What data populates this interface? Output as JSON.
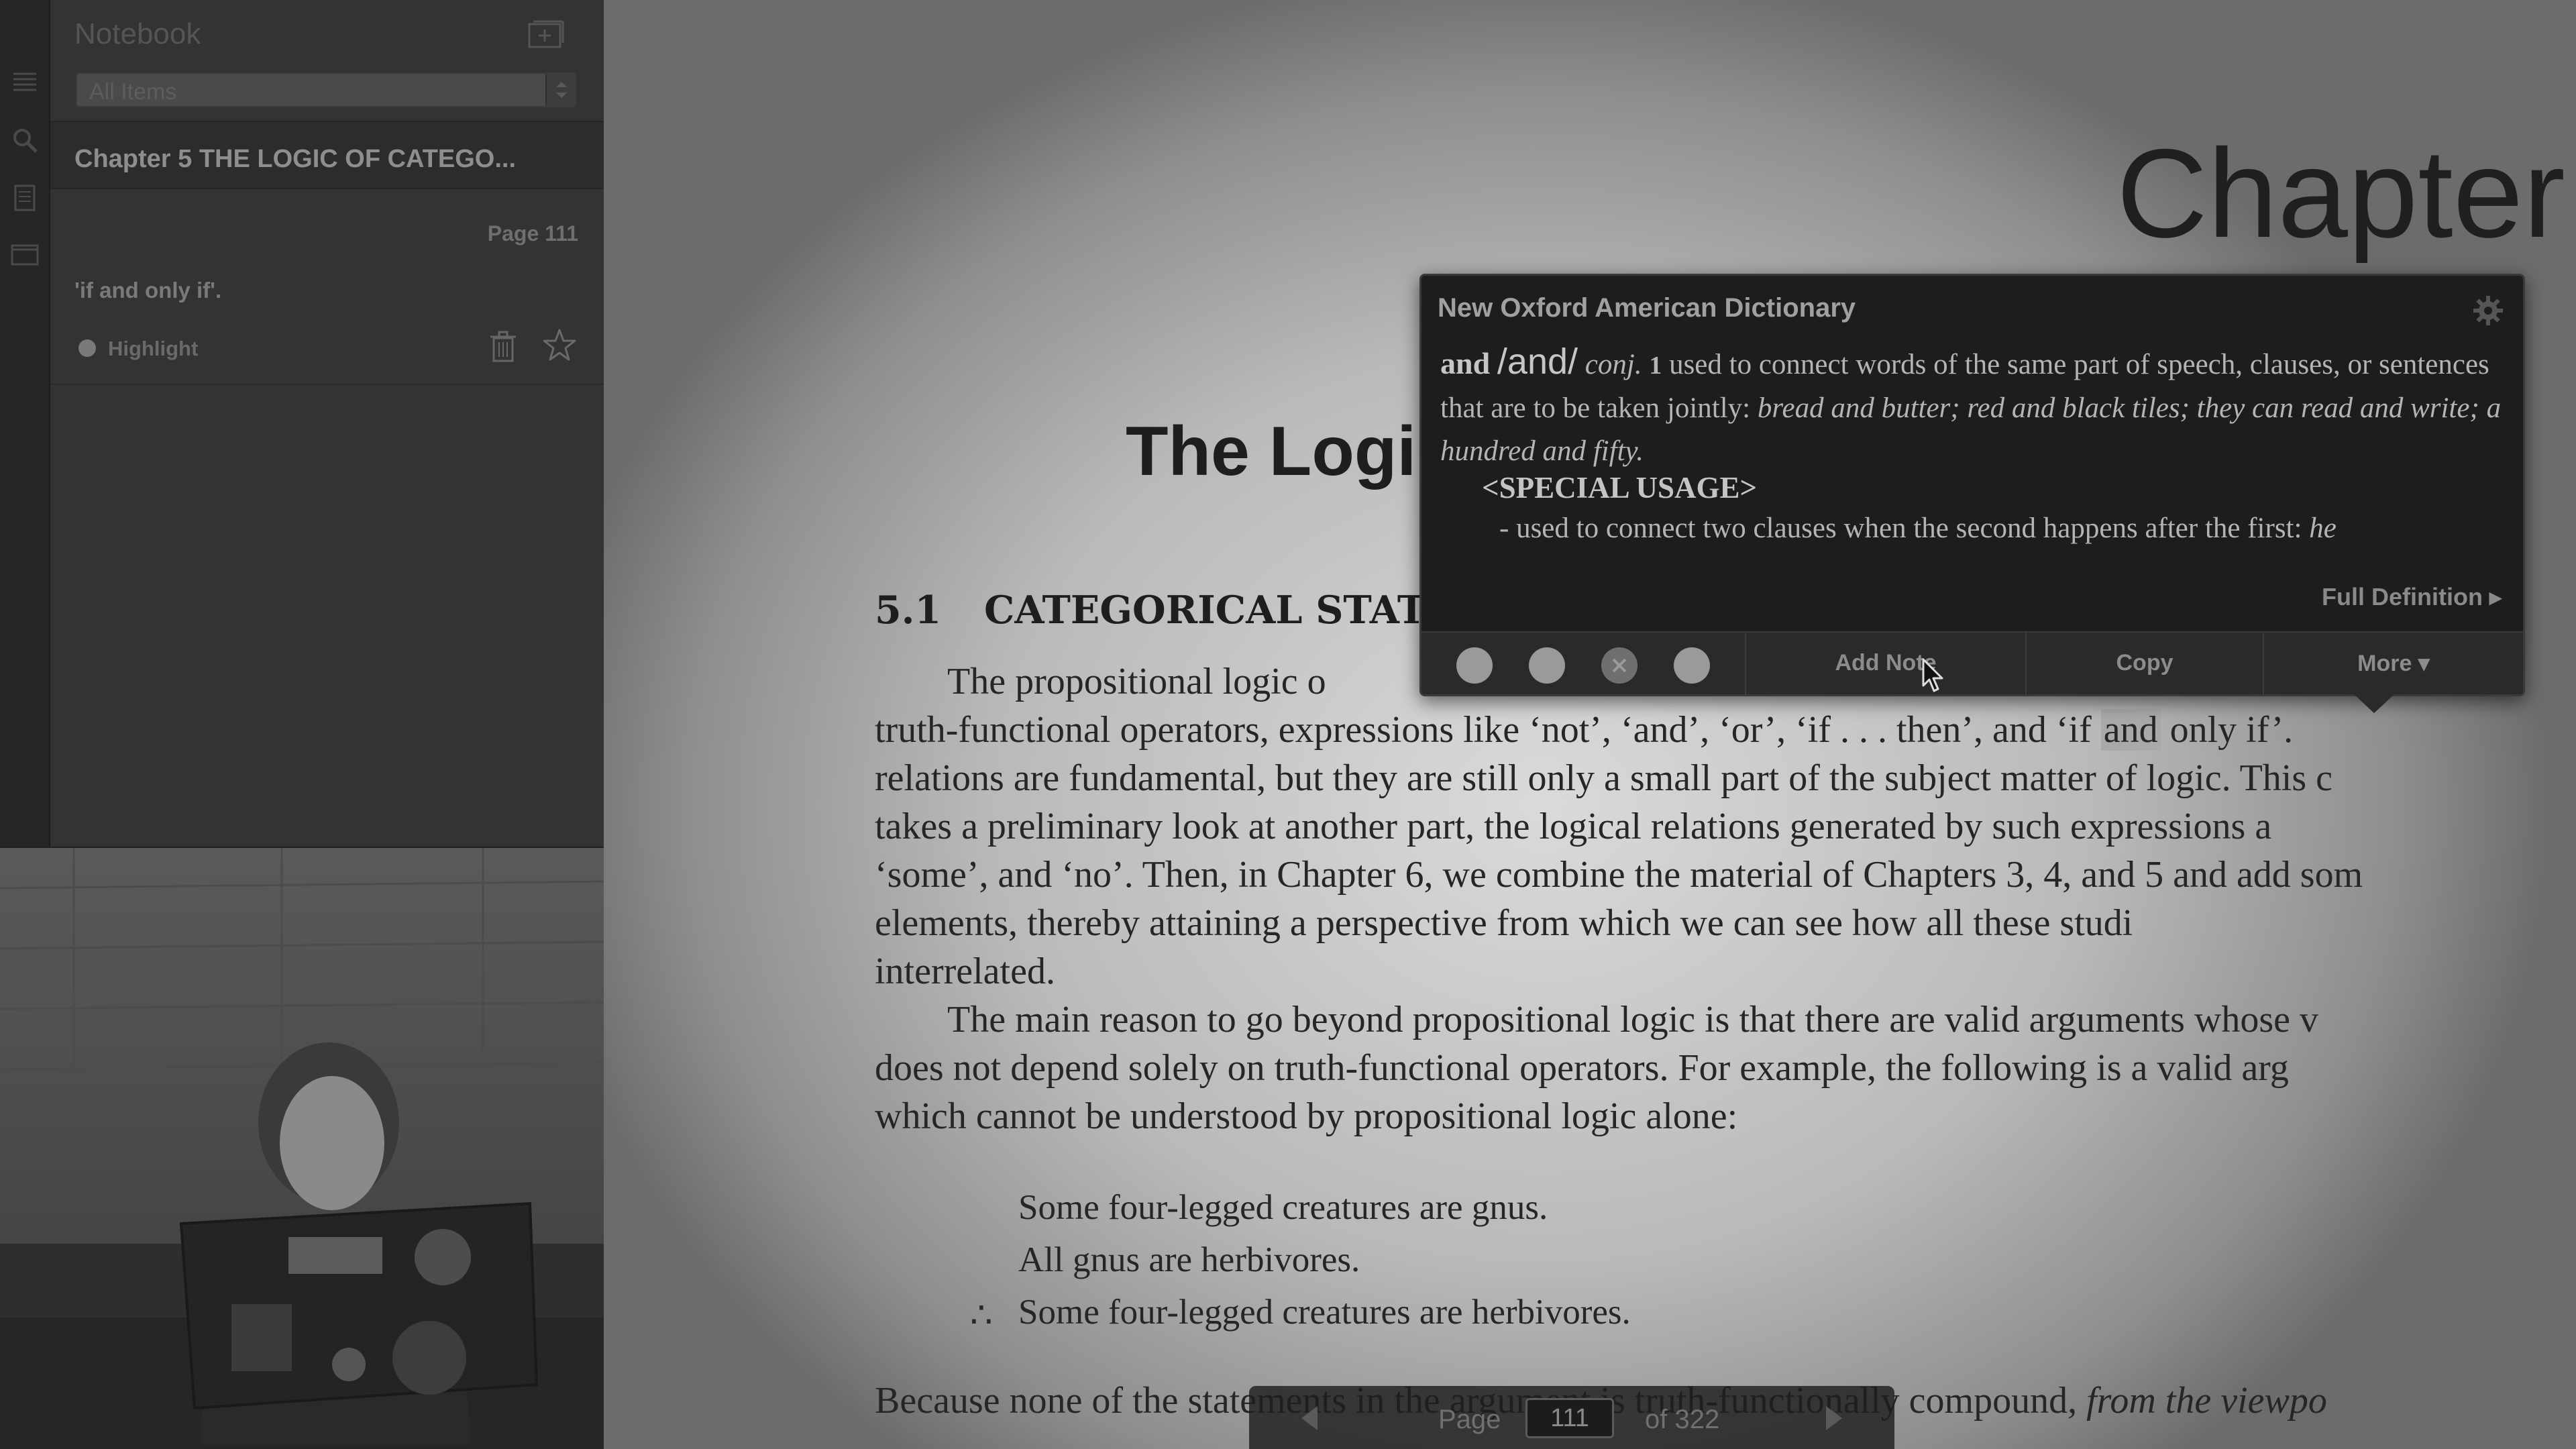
{
  "sidebar": {
    "notebook_title": "Notebook",
    "filter_value": "All Items",
    "chapter_title": "Chapter 5 THE LOGIC OF CATEGO...",
    "note": {
      "page": "Page 111",
      "quote": "'if and only if'.",
      "type_label": "Highlight"
    },
    "rail_icons": [
      "list-icon",
      "search-icon",
      "page-icon",
      "notebook-icon"
    ]
  },
  "document": {
    "chapter_word": "Chapter",
    "heading_fragment": "The Logi",
    "section_number": "5.1",
    "section_title": "CATEGORICAL STATE",
    "lines": [
      {
        "text": "The propositional logic o",
        "indent": true
      },
      {
        "text": "truth-functional operators, expressions like ‘not’, ‘and’, ‘or’, ‘if . . . then’, and ‘if ",
        "highlight": "and",
        "after": " only if’.",
        "indent": false
      },
      {
        "text": "relations are fundamental, but they are still only a small part of the subject matter of logic. This c",
        "indent": false
      },
      {
        "text": "takes a preliminary look at another part, the logical relations generated by such expressions a",
        "indent": false
      },
      {
        "text": "‘some’, and ‘no’. Then, in Chapter 6, we combine the material of Chapters 3, 4, and 5 and add som",
        "indent": false
      },
      {
        "text": "elements, thereby attaining a perspective from which we can see how all these studi",
        "indent": false
      },
      {
        "text": "interrelated.",
        "indent": false
      },
      {
        "text": "The main reason to go beyond propositional logic is that there are valid arguments whose v",
        "indent": true
      },
      {
        "text": "does not depend solely on truth-functional operators. For example, the following is a valid arg",
        "indent": false
      },
      {
        "text": "which cannot be understood by propositional logic alone:",
        "indent": false
      }
    ],
    "argument": [
      "Some four-legged creatures are gnus.",
      "All gnus are herbivores.",
      "Some four-legged creatures are herbivores."
    ],
    "therefore_symbol": "∴",
    "last_line": "Because none of the statements in the argument is truth-functionally compound, ",
    "last_line_italic": "from the viewpo"
  },
  "dictionary": {
    "source": "New Oxford American Dictionary",
    "headword": "and",
    "pronunciation": "/and/",
    "part_of_speech": "conj.",
    "sense_number": "1",
    "definition": "used to connect words of the same part of speech, clauses, or sentences that are to be taken jointly: ",
    "examples": "bread and butter; red and black tiles; they can read and write; a hundred and fifty.",
    "usage_heading": "<SPECIAL USAGE>",
    "usage_line": "- used to connect two clauses when the second happens after the first: ",
    "usage_example": "he",
    "full_definition_label": "Full Definition ▸",
    "toolbar": {
      "add_note": "Add Note",
      "copy": "Copy",
      "more": "More ▾"
    }
  },
  "page_nav": {
    "label": "Page",
    "current": "111",
    "total": "of 322"
  }
}
